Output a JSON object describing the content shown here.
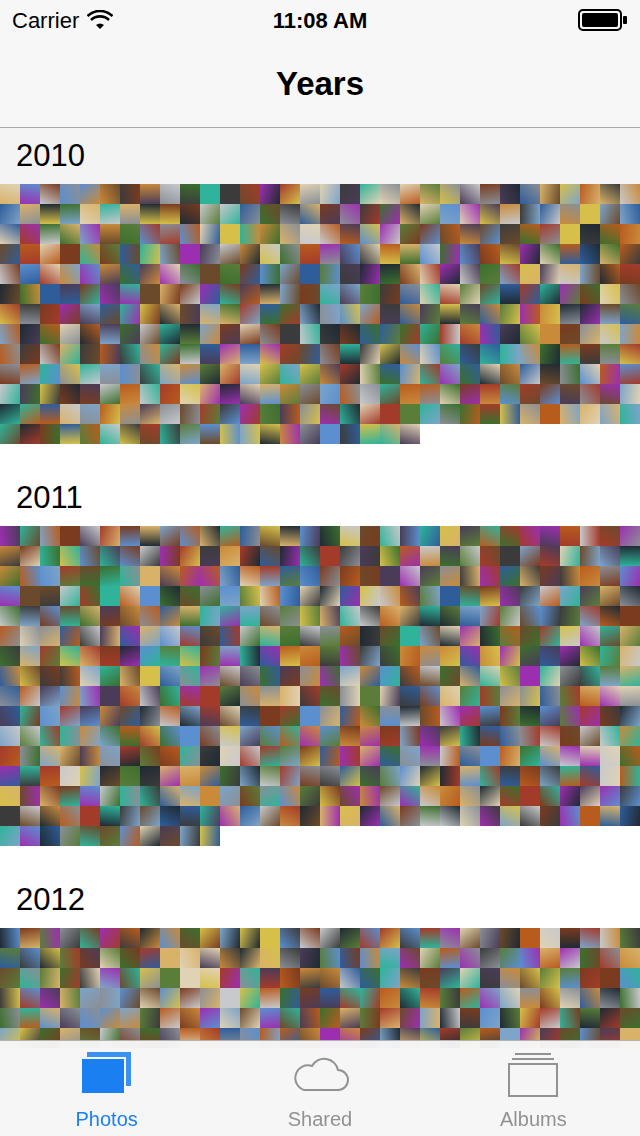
{
  "status_bar": {
    "carrier": "Carrier",
    "time": "11:08 AM",
    "battery_level": 1
  },
  "nav": {
    "title": "Years"
  },
  "sections": [
    {
      "year": "2010",
      "pinned": true,
      "photo_count": 405
    },
    {
      "year": "2011",
      "pinned": false,
      "photo_count": 491
    },
    {
      "year": "2012",
      "pinned": false,
      "photo_count": 192
    }
  ],
  "tabs": [
    {
      "label": "Photos",
      "selected": true
    },
    {
      "label": "Shared",
      "selected": false
    },
    {
      "label": "Albums",
      "selected": false
    }
  ]
}
